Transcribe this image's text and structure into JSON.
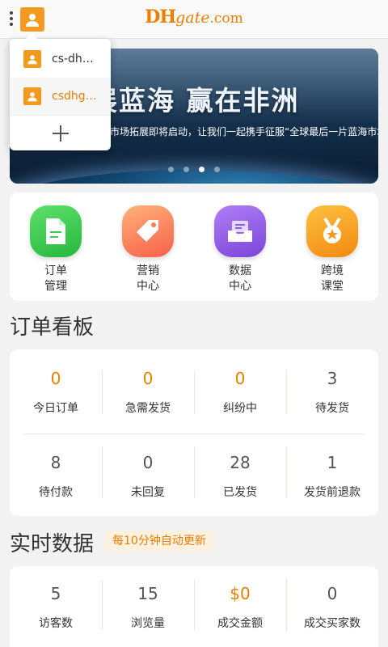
{
  "header": {
    "logo_dh": "DH",
    "logo_gate": "gate",
    "logo_com": ".com"
  },
  "banner": {
    "headline": "展蓝海  赢在非洲",
    "subline": "市场拓展即将启动，让我们一起携手征服“全球最后一片蓝海市场”。",
    "slide_count": 4,
    "active_slide": 3
  },
  "account_dropdown": {
    "accounts": [
      {
        "label": "cs-dh…",
        "selected": false
      },
      {
        "label": "csdhg…",
        "selected": true
      }
    ],
    "add_label": "+"
  },
  "quick_menu": [
    {
      "label_line1": "订单",
      "label_line2": "管理",
      "icon": "order-document-icon",
      "color": "#3ccb52"
    },
    {
      "label_line1": "营销",
      "label_line2": "中心",
      "icon": "tag-icon",
      "color": "#f8604a"
    },
    {
      "label_line1": "数据",
      "label_line2": "中心",
      "icon": "inbox-data-icon",
      "color": "#8d5ce6"
    },
    {
      "label_line1": "跨境",
      "label_line2": "课堂",
      "icon": "medal-icon",
      "color": "#f49b1e"
    }
  ],
  "order_board": {
    "title": "订单看板",
    "row1": [
      {
        "value": "0",
        "label": "今日订单",
        "highlight": true
      },
      {
        "value": "0",
        "label": "急需发货",
        "highlight": true
      },
      {
        "value": "0",
        "label": "纠纷中",
        "highlight": true
      },
      {
        "value": "3",
        "label": "待发货",
        "highlight": false
      }
    ],
    "row2": [
      {
        "value": "8",
        "label": "待付款",
        "highlight": false
      },
      {
        "value": "0",
        "label": "未回复",
        "highlight": false
      },
      {
        "value": "28",
        "label": "已发货",
        "highlight": false
      },
      {
        "value": "1",
        "label": "发货前退款",
        "highlight": false
      }
    ]
  },
  "realtime": {
    "title": "实时数据",
    "badge": "每10分钟自动更新",
    "stats": [
      {
        "value": "5",
        "label": "访客数",
        "highlight": false
      },
      {
        "value": "15",
        "label": "浏览量",
        "highlight": false
      },
      {
        "value": "$0",
        "label": "成交金额",
        "highlight": true
      },
      {
        "value": "0",
        "label": "成交买家数",
        "highlight": false
      }
    ]
  },
  "colors": {
    "accent": "#f07c00",
    "avatar": "#f29a1f",
    "divider": "#f3e4d6"
  }
}
